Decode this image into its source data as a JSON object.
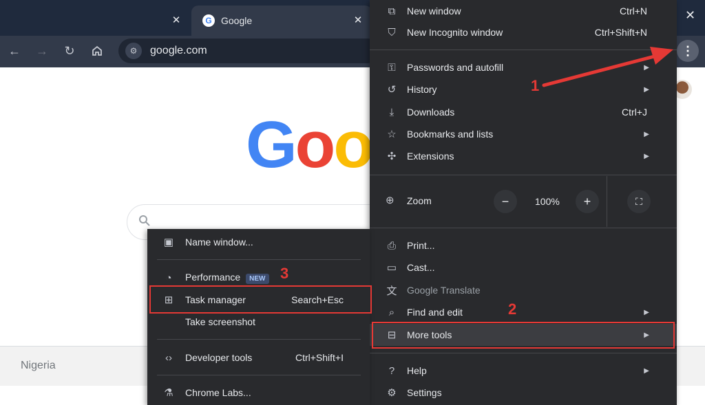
{
  "tabs": [
    {
      "label": ""
    },
    {
      "label": "Google"
    }
  ],
  "tab_close_glyph": "✕",
  "toolbar": {
    "url": "google.com"
  },
  "page": {
    "logo_text": "Goo",
    "footer_country": "Nigeria"
  },
  "main_menu": {
    "new_window": {
      "label": "New window",
      "shortcut": "Ctrl+N"
    },
    "new_incognito": {
      "label": "New Incognito window",
      "shortcut": "Ctrl+Shift+N"
    },
    "passwords": {
      "label": "Passwords and autofill"
    },
    "history": {
      "label": "History"
    },
    "downloads": {
      "label": "Downloads",
      "shortcut": "Ctrl+J"
    },
    "bookmarks": {
      "label": "Bookmarks and lists"
    },
    "extensions": {
      "label": "Extensions"
    },
    "zoom": {
      "label": "Zoom",
      "value": "100%",
      "minus": "−",
      "plus": "+"
    },
    "print": {
      "label": "Print..."
    },
    "cast": {
      "label": "Cast..."
    },
    "translate": {
      "label": "Google Translate"
    },
    "find_edit": {
      "label": "Find and edit"
    },
    "more_tools": {
      "label": "More tools"
    },
    "help": {
      "label": "Help"
    },
    "settings": {
      "label": "Settings"
    }
  },
  "sub_menu": {
    "name_window": {
      "label": "Name window..."
    },
    "performance": {
      "label": "Performance",
      "badge": "NEW"
    },
    "task_manager": {
      "label": "Task manager",
      "shortcut": "Search+Esc"
    },
    "screenshot": {
      "label": "Take screenshot"
    },
    "dev_tools": {
      "label": "Developer tools",
      "shortcut": "Ctrl+Shift+I"
    },
    "chrome_labs": {
      "label": "Chrome Labs..."
    }
  },
  "annotations": {
    "step1": "1",
    "step2": "2",
    "step3": "3"
  },
  "colors": {
    "annotation_red": "#e53935",
    "menu_bg": "#292a2d",
    "tabstrip_bg": "#1f2a3d",
    "google_blue": "#4285f4",
    "google_red": "#ea4335",
    "google_yellow": "#fbbc05"
  }
}
